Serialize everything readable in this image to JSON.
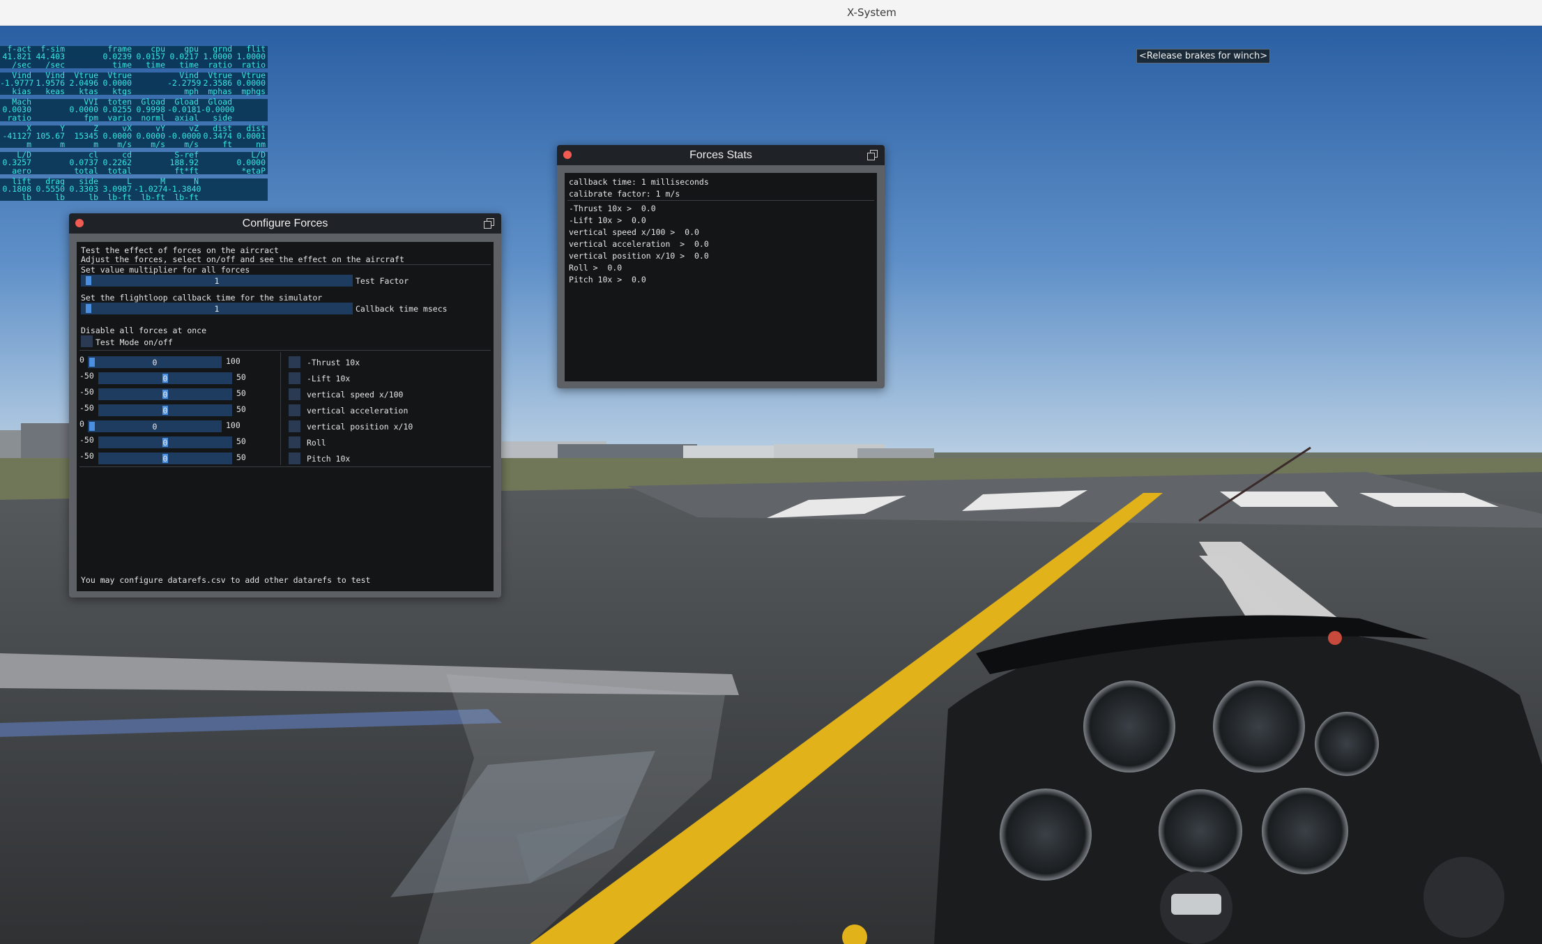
{
  "window": {
    "title": "X-System"
  },
  "message": {
    "winch": "<Release brakes for winch>"
  },
  "data_table": [
    {
      "values": [
        "41.821",
        "44.403",
        "",
        "0.0239",
        "0.0157",
        "0.0217",
        "1.0000",
        "1.0000"
      ],
      "labels": [
        "/sec",
        "/sec",
        "",
        "time",
        "time",
        "time",
        "ratio",
        "ratio"
      ],
      "headers": [
        "f-act",
        "f-sim",
        "",
        "frame",
        "cpu",
        "gpu",
        "grnd",
        "flit"
      ]
    },
    {
      "values": [
        "-1.9777",
        "1.9576",
        "2.0496",
        "0.0000",
        "",
        "-2.2759",
        "2.3586",
        "0.0000"
      ],
      "labels": [
        "kias",
        "keas",
        "ktas",
        "ktgs",
        "",
        "mph",
        "mphas",
        "mphgs"
      ],
      "headers": [
        "Vind",
        "Vind",
        "Vtrue",
        "Vtrue",
        "",
        "Vind",
        "Vtrue",
        "Vtrue"
      ]
    },
    {
      "values": [
        "0.0030",
        "",
        "0.0000",
        "0.0255",
        "0.9998",
        "-0.0181",
        "-0.0000",
        ""
      ],
      "labels": [
        "ratio",
        "",
        "fpm",
        "vario",
        "norml",
        "axial",
        "side",
        ""
      ],
      "headers": [
        "Mach",
        "",
        "VVI",
        "toten",
        "Gload",
        "Gload",
        "Gload",
        ""
      ]
    },
    {
      "values": [
        "-41127",
        "105.67",
        "15345",
        "0.0000",
        "0.0000",
        "-0.0000",
        "0.3474",
        "0.0001"
      ],
      "labels": [
        "m",
        "m",
        "m",
        "m/s",
        "m/s",
        "m/s",
        "ft",
        "nm"
      ],
      "headers": [
        "X",
        "Y",
        "Z",
        "vX",
        "vY",
        "vZ",
        "dist",
        "dist"
      ]
    },
    {
      "values": [
        "0.3257",
        "",
        "0.0737",
        "0.2262",
        "",
        "188.92",
        "",
        "0.0000"
      ],
      "labels": [
        "aero",
        "",
        "total",
        "total",
        "",
        "ft*ft",
        "",
        "*etaP"
      ],
      "headers": [
        "L/D",
        "",
        "cl",
        "cd",
        "",
        "S-ref",
        "",
        "L/D"
      ]
    },
    {
      "values": [
        "0.1808",
        "0.5550",
        "0.3303",
        "3.0987",
        "-1.0274",
        "-1.3840",
        "",
        ""
      ],
      "labels": [
        "lb",
        "lb",
        "lb",
        "lb-ft",
        "lb-ft",
        "lb-ft",
        "",
        ""
      ],
      "headers": [
        "lift",
        "drag",
        "side",
        "L",
        "M",
        "N",
        "",
        ""
      ]
    }
  ],
  "configure_forces": {
    "title": "Configure Forces",
    "intro_1": "Test the effect of forces on the aircract",
    "intro_2": "Adjust the forces, select on/off and see the effect on the aircraft",
    "multiplier_label": "Set value multiplier for all forces",
    "test_factor_value": "1",
    "test_factor_label": "Test Factor",
    "callback_label": "Set the flightloop callback time for the simulator",
    "callback_value": "1",
    "callback_slider_label": "Callback time msecs",
    "disable_label": "Disable all forces at once",
    "test_mode_label": "Test Mode on/off",
    "footer": "You may configure datarefs.csv to add other datarefs to test",
    "forces": [
      {
        "min": "0",
        "value": "0",
        "max": "100",
        "name": "-Thrust 10x"
      },
      {
        "min": "-50",
        "value": "0",
        "max": "50",
        "name": "-Lift 10x"
      },
      {
        "min": "-50",
        "value": "0",
        "max": "50",
        "name": "vertical speed x/100"
      },
      {
        "min": "-50",
        "value": "0",
        "max": "50",
        "name": "vertical acceleration"
      },
      {
        "min": "0",
        "value": "0",
        "max": "100",
        "name": "vertical position x/10"
      },
      {
        "min": "-50",
        "value": "0",
        "max": "50",
        "name": "Roll"
      },
      {
        "min": "-50",
        "value": "0",
        "max": "50",
        "name": "Pitch 10x"
      }
    ]
  },
  "forces_stats": {
    "title": "Forces Stats",
    "callback_time": "callback time: 1 milliseconds",
    "calibrate_factor": "calibrate factor: 1 m/s",
    "rows": [
      "-Thrust 10x >  0.0",
      "-Lift 10x >  0.0",
      "vertical speed x/100 >  0.0",
      "vertical acceleration  >  0.0",
      "vertical position x/10 >  0.0",
      "Roll >  0.0",
      "Pitch 10x >  0.0"
    ]
  },
  "colors": {
    "data_text": "#39e6e6",
    "data_bg": "#083452",
    "slider_bg": "#1e3b60",
    "slider_fill": "#4a8fe0",
    "close_button": "#f25b52"
  }
}
